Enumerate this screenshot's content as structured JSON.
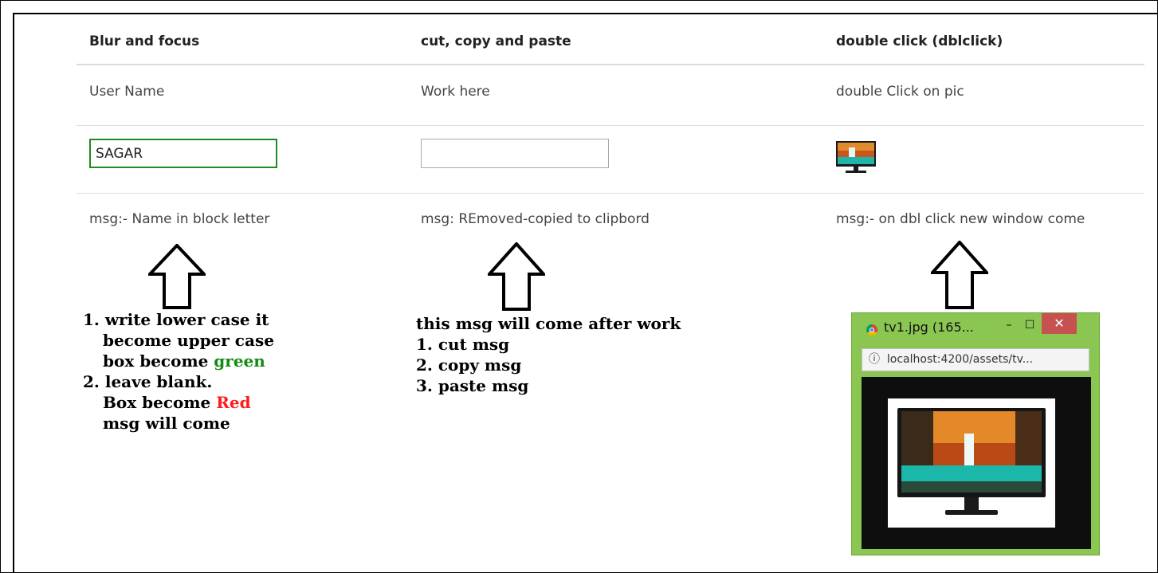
{
  "columns": {
    "blur": {
      "header": "Blur and focus",
      "label": "User Name",
      "input_value": "SAGAR",
      "msg": "msg:- Name in block letter",
      "note_lines": [
        "1. write lower case it",
        "become upper case",
        "box become",
        "green",
        "2. leave blank.",
        "Box become",
        "Red",
        "msg will come"
      ]
    },
    "cut": {
      "header": "cut, copy and paste",
      "label": "Work here",
      "input_value": "",
      "msg": "msg: REmoved-copied to clipbord",
      "note_lines": [
        "this msg will come after work",
        "1. cut msg",
        "2. copy msg",
        "3. paste msg"
      ]
    },
    "dbl": {
      "header": "double click (dblclick)",
      "label": "double Click on pic",
      "msg": "msg:- on dbl click new window come",
      "thumb_icon": "tv-image-thumbnail"
    }
  },
  "popup": {
    "title": "tv1.jpg (165...",
    "minimize": "–",
    "maximize": "☐",
    "close": "✕",
    "url": "localhost:4200/assets/tv...",
    "info_icon": "ⓘ",
    "image_icon": "tv-image"
  },
  "colors": {
    "valid_border": "#1e8b1e",
    "green_text": "#138a13",
    "red_text": "#ff1a1a",
    "popup_frame": "#8bc653"
  }
}
